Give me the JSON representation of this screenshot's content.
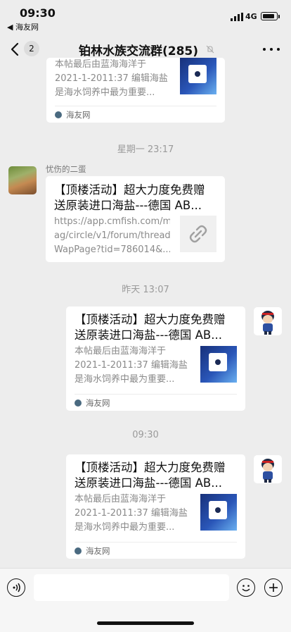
{
  "status_bar": {
    "time": "09:30",
    "back_app": "◀ 海友网",
    "network": "4G"
  },
  "nav": {
    "unread_count": "2",
    "title": "铂林水族交流群(285)"
  },
  "messages": [
    {
      "kind": "card",
      "side": "left-partial",
      "title": "",
      "desc": [
        "本帖最后由蓝海海洋于",
        "2021-1-2011:37 编辑海盐",
        "是海水饲养中最为重要..."
      ],
      "source": "海友网"
    },
    {
      "kind": "timestamp",
      "text": "星期一 23:17"
    },
    {
      "kind": "card",
      "side": "left",
      "sender": "忧伤的二蛋",
      "title": [
        "【顶楼活动】超大力度免费赠",
        "送原装进口海盐---德国 AB..."
      ],
      "desc": [
        "https://app.cmfish.com/m",
        "ag/circle/v1/forum/thread",
        "WapPage?tid=786014&..."
      ]
    },
    {
      "kind": "timestamp",
      "text": "昨天 13:07"
    },
    {
      "kind": "card",
      "side": "right",
      "title": [
        "【顶楼活动】超大力度免费赠",
        "送原装进口海盐---德国 AB..."
      ],
      "desc": [
        "本帖最后由蓝海海洋于",
        "2021-1-2011:37 编辑海盐",
        "是海水饲养中最为重要..."
      ],
      "source": "海友网"
    },
    {
      "kind": "timestamp",
      "text": "09:30"
    },
    {
      "kind": "card",
      "side": "right",
      "title": [
        "【顶楼活动】超大力度免费赠",
        "送原装进口海盐---德国 AB..."
      ],
      "desc": [
        "本帖最后由蓝海海洋于",
        "2021-1-2011:37 编辑海盐",
        "是海水饲养中最为重要..."
      ],
      "source": "海友网"
    }
  ]
}
